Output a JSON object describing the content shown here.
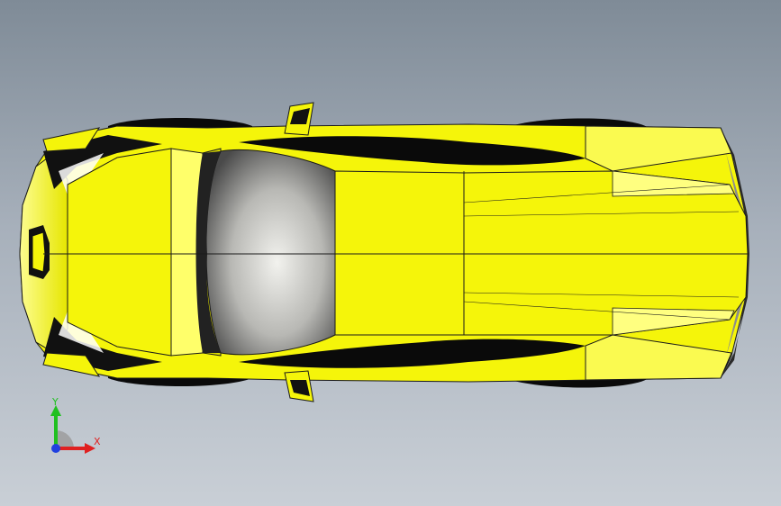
{
  "viewport": {
    "background_top": "#7f8b97",
    "background_bottom": "#c9cfd6"
  },
  "model": {
    "body_color": "#f5f50a",
    "edge_color": "#1a1a1a",
    "glass_color": "#9a9a9a",
    "shadow_color": "#000000"
  },
  "triad": {
    "x_label": "X",
    "y_label": "Y",
    "x_color": "#e02020",
    "y_color": "#20c020",
    "z_color": "#2040e0"
  }
}
